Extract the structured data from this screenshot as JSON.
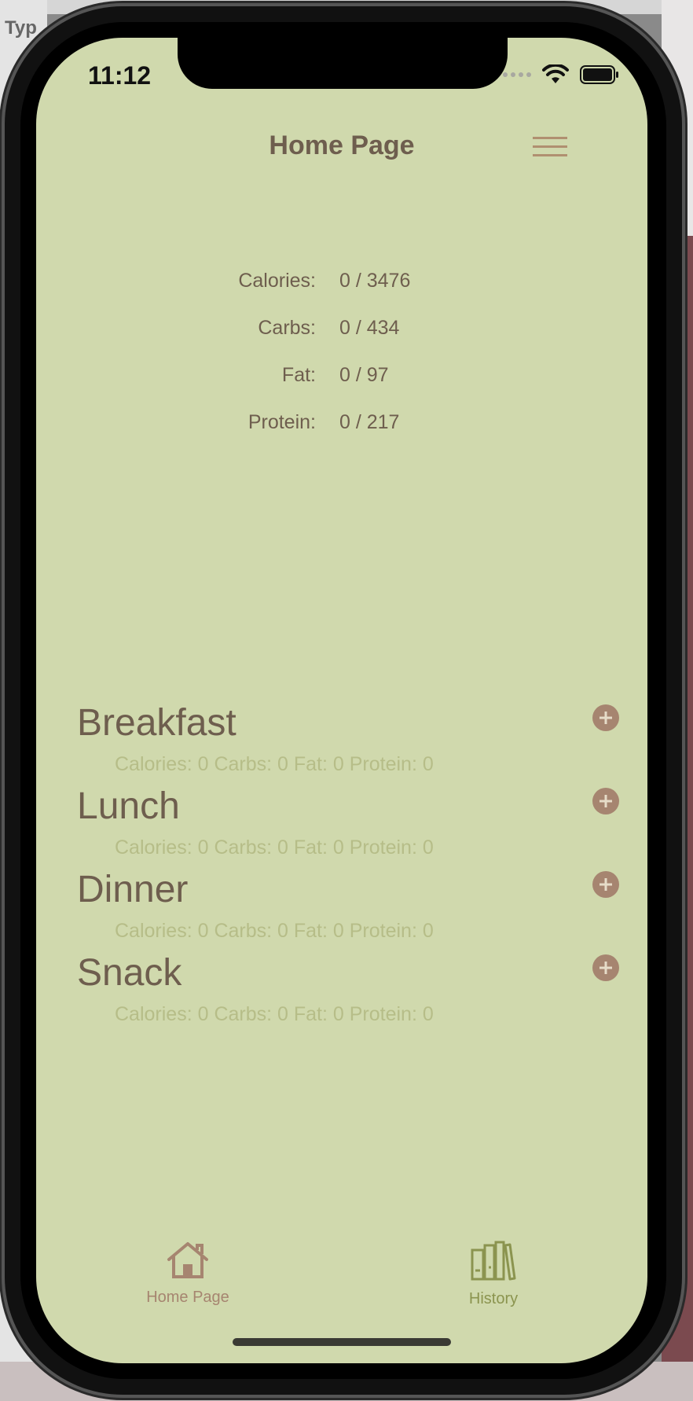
{
  "background": {
    "partial_text": "Typ"
  },
  "status_bar": {
    "time": "11:12"
  },
  "header": {
    "title": "Home Page",
    "menu_icon": "hamburger-menu-icon"
  },
  "macros": [
    {
      "label": "Calories:",
      "value": "0 / 3476"
    },
    {
      "label": "Carbs:",
      "value": "0 / 434"
    },
    {
      "label": "Fat:",
      "value": "0 / 97"
    },
    {
      "label": "Protein:",
      "value": "0 / 217"
    }
  ],
  "meals": [
    {
      "name": "Breakfast",
      "stats": "Calories: 0 Carbs: 0 Fat: 0 Protein: 0"
    },
    {
      "name": "Lunch",
      "stats": "Calories: 0 Carbs: 0 Fat: 0 Protein: 0"
    },
    {
      "name": "Dinner",
      "stats": "Calories: 0 Carbs: 0 Fat: 0 Protein: 0"
    },
    {
      "name": "Snack",
      "stats": "Calories: 0 Carbs: 0 Fat: 0 Protein: 0"
    }
  ],
  "tabbar": {
    "home": {
      "label": "Home Page",
      "icon": "house-icon"
    },
    "history": {
      "label": "History",
      "icon": "books-icon"
    }
  },
  "colors": {
    "screen_bg": "#d0d9ad",
    "text_primary": "#6e5e4e",
    "text_muted": "#b6bd88",
    "accent": "#a68570",
    "history_tab": "#8b944f"
  }
}
